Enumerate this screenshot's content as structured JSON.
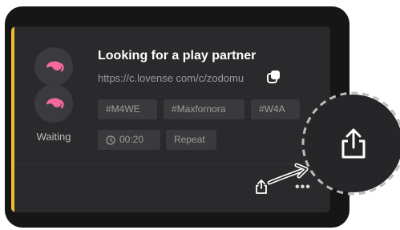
{
  "card": {
    "title": "Looking for a play partner",
    "link": "https://c.lovense com/c/zodomu",
    "status": "Waiting",
    "tags": [
      "#M4WE",
      "#Maxfornora",
      "#W4A"
    ],
    "timer": "00:20",
    "repeat_label": "Repeat"
  },
  "icons": {
    "avatar_1": "lovense-toy-icon",
    "avatar_2": "lovense-toy-icon",
    "copy": "copy-icon",
    "timer": "clock-icon",
    "share": "share-icon",
    "more": "more-dots-icon",
    "share_zoomed": "share-icon"
  },
  "colors": {
    "accent": "#f2be2a",
    "brand_pink": "#f36a9a",
    "card_bg": "#2a2a2c",
    "frame_bg": "#161617"
  }
}
